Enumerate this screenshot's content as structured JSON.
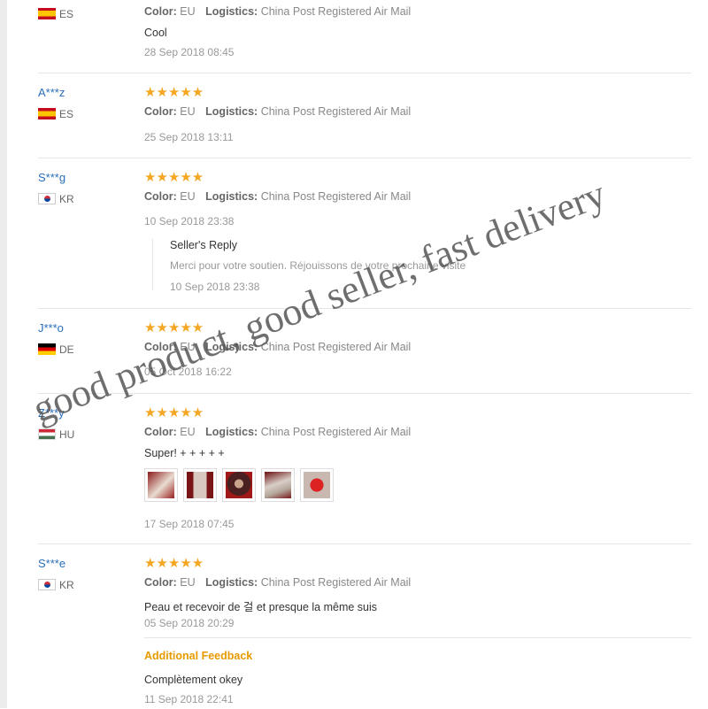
{
  "reviews": [
    {
      "user": "",
      "country": "ES",
      "stars": "",
      "color_label": "Color:",
      "color_value": "EU",
      "logistics_label": "Logistics:",
      "logistics_value": "China Post Registered Air Mail",
      "text": "Cool",
      "date": "28 Sep 2018 08:45"
    },
    {
      "user": "A***z",
      "country": "ES",
      "stars": "★★★★★",
      "rating": 5,
      "color_label": "Color:",
      "color_value": "EU",
      "logistics_label": "Logistics:",
      "logistics_value": "China Post Registered Air Mail",
      "date": "25 Sep 2018 13:11"
    },
    {
      "user": "S***g",
      "country": "KR",
      "stars": "★★★★★",
      "rating": 5,
      "color_label": "Color:",
      "color_value": "EU",
      "logistics_label": "Logistics:",
      "logistics_value": "China Post Registered Air Mail",
      "date": "10 Sep 2018 23:38",
      "reply": {
        "title": "Seller's Reply",
        "text": "Merci pour votre soutien. Réjouissons de votre prochaine visite",
        "date": "10 Sep 2018 23:38"
      }
    },
    {
      "user": "J***o",
      "country": "DE",
      "stars": "★★★★★",
      "rating": 5,
      "color_label": "Color:",
      "color_value": "EU",
      "logistics_label": "Logistics:",
      "logistics_value": "China Post Registered Air Mail",
      "date": "05 Oct 2018 16:22"
    },
    {
      "user": "Z***y",
      "country": "HU",
      "stars": "★★★★★",
      "rating": 5,
      "color_label": "Color:",
      "color_value": "EU",
      "logistics_label": "Logistics:",
      "logistics_value": "China Post Registered Air Mail",
      "text": "Super! + + + + +",
      "photo_count": 5,
      "date": "17 Sep 2018 07:45"
    },
    {
      "user": "S***e",
      "country": "KR",
      "stars": "★★★★★",
      "rating": 5,
      "color_label": "Color:",
      "color_value": "EU",
      "logistics_label": "Logistics:",
      "logistics_value": "China Post Registered Air Mail",
      "text": "Peau et recevoir de 걸 et presque la même suis",
      "date": "05 Sep 2018 20:29",
      "additional": {
        "title": "Additional Feedback",
        "text": "Complètement okey",
        "date": "11 Sep 2018 22:41"
      }
    }
  ],
  "watermark": "good product,   good seller,   fast delivery",
  "colors": {
    "star": "#f5a623",
    "username": "#2a6ebb",
    "additional_feedback": "#e69a00"
  }
}
